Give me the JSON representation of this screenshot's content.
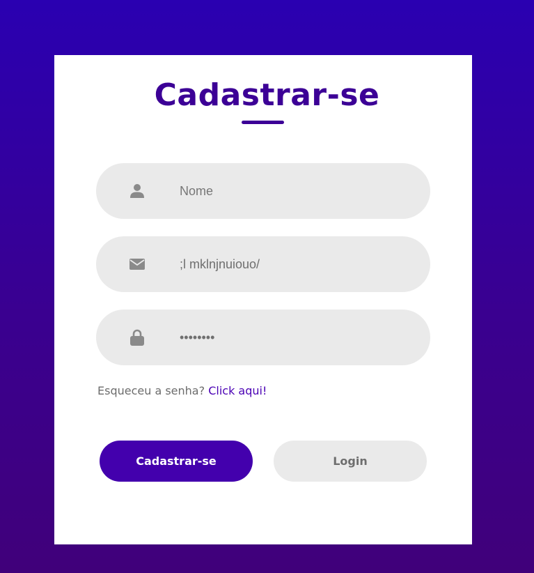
{
  "form": {
    "title": "Cadastrar-se",
    "fields": {
      "name": {
        "icon": "user-icon",
        "placeholder": "Nome",
        "value": ""
      },
      "email": {
        "icon": "envelope-icon",
        "placeholder": "",
        "value": ";l mklnjnuiouo/"
      },
      "password": {
        "icon": "lock-icon",
        "placeholder": "",
        "value": "••••••••"
      }
    },
    "forgot": {
      "text": "Esqueceu a senha?",
      "link": "Click aqui!"
    },
    "buttons": {
      "signup": "Cadastrar-se",
      "login": "Login"
    }
  },
  "colors": {
    "accent": "#3c0096",
    "button_primary": "#4300ad",
    "field_bg": "#eaeaea",
    "background_top": "#2a00b1",
    "background_bottom": "#40007a"
  }
}
